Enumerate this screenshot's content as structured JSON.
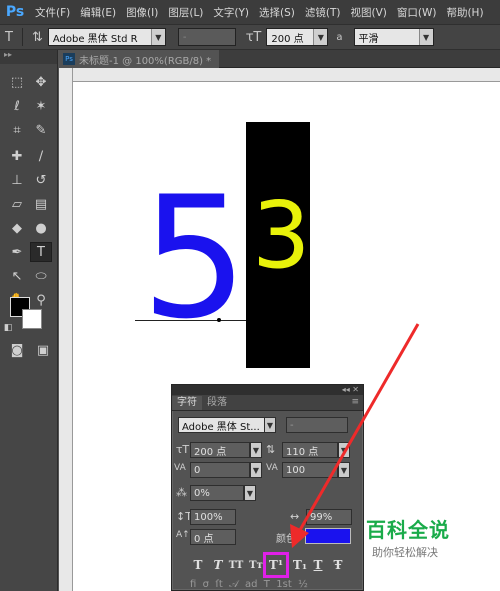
{
  "menubar": {
    "logo": "Ps",
    "items": [
      "文件(F)",
      "编辑(E)",
      "图像(I)",
      "图层(L)",
      "文字(Y)",
      "选择(S)",
      "滤镜(T)",
      "视图(V)",
      "窗口(W)",
      "帮助(H)"
    ]
  },
  "options": {
    "font_family": "Adobe 黑体 Std R",
    "font_style": "-",
    "font_size": "200 点",
    "aa_label": "a",
    "antialias": "平滑"
  },
  "document": {
    "tab_title": "未标题-1 @ 100%(RGB/8) *",
    "badge": "Ps"
  },
  "canvas": {
    "digit_left": "5",
    "digit_right": "3",
    "left_color": "#1a12ee",
    "right_color": "#e8f20a"
  },
  "character_panel": {
    "tab_character": "字符",
    "tab_paragraph": "段落",
    "font_family": "Adobe 黑体 St...",
    "font_style": "-",
    "font_size": "200 点",
    "leading": "110 点",
    "kerning": "0",
    "tracking": "100",
    "tsume": "0%",
    "vertical_scale": "100%",
    "horizontal_scale": "99%",
    "baseline_shift": "0 点",
    "color_label": "颜色:",
    "color_value": "#1a12ee",
    "style_buttons": [
      "T",
      "T",
      "TT",
      "Tт",
      "T¹",
      "T₁",
      "T",
      "Ŧ"
    ]
  },
  "watermark": {
    "title": "百科全说",
    "subtitle": "助你轻松解决"
  },
  "accent": {
    "highlight": "#e020e8",
    "arrow": "#ee2a2a"
  }
}
